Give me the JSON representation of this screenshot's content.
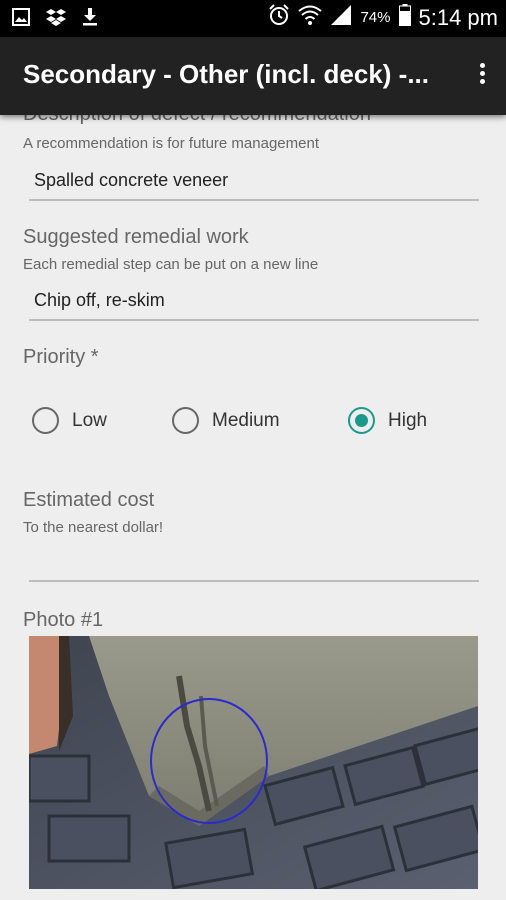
{
  "status_bar": {
    "time": "5:14 pm",
    "battery_percent": "74%",
    "left_icons": [
      "image-icon",
      "dropbox-icon",
      "download-icon"
    ],
    "right_icons": [
      "alarm-icon",
      "wifi-icon",
      "signal-icon",
      "battery-icon"
    ]
  },
  "app_bar": {
    "title": "Secondary - Other (incl. deck) -..."
  },
  "form": {
    "description": {
      "label": "Description of defect / recommendation *",
      "hint": "A recommendation is for future management",
      "value": "Spalled concrete veneer"
    },
    "remedial": {
      "label": "Suggested remedial work",
      "hint": "Each remedial step can be put on a new line",
      "value": "Chip off, re-skim"
    },
    "priority": {
      "label": "Priority *",
      "options": [
        "Low",
        "Medium",
        "High"
      ],
      "selected": "High"
    },
    "cost": {
      "label": "Estimated cost",
      "hint": "To the nearest dollar!",
      "value": ""
    },
    "photo": {
      "label": "Photo #1"
    }
  },
  "colors": {
    "accent": "#1a9a8a",
    "app_bar": "#222222",
    "background": "#eeeeee"
  }
}
